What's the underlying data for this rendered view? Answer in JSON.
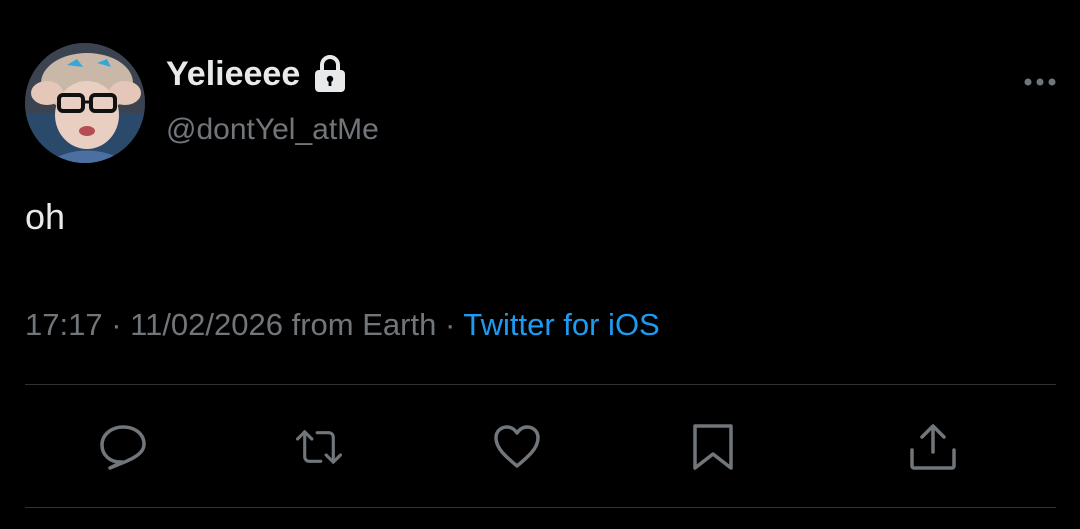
{
  "author": {
    "display_name": "Yelieeee",
    "handle": "@dontYel_atMe",
    "protected_icon": "lock-icon",
    "avatar": "profile-photo"
  },
  "tweet": {
    "text": "oh",
    "time": "17:17",
    "date": "11/02/2026",
    "location": "from Earth",
    "source": "Twitter for iOS"
  },
  "actions": [
    {
      "name": "reply",
      "icon": "speech-bubble-icon"
    },
    {
      "name": "retweet",
      "icon": "retweet-arrows-icon"
    },
    {
      "name": "like",
      "icon": "heart-icon"
    },
    {
      "name": "bookmark",
      "icon": "bookmark-icon"
    },
    {
      "name": "share",
      "icon": "share-upload-icon"
    }
  ],
  "colors": {
    "background": "#000000",
    "text_primary": "#e7e9ea",
    "text_secondary": "#71767b",
    "link": "#1d9bf0",
    "divider": "#2f3336"
  }
}
